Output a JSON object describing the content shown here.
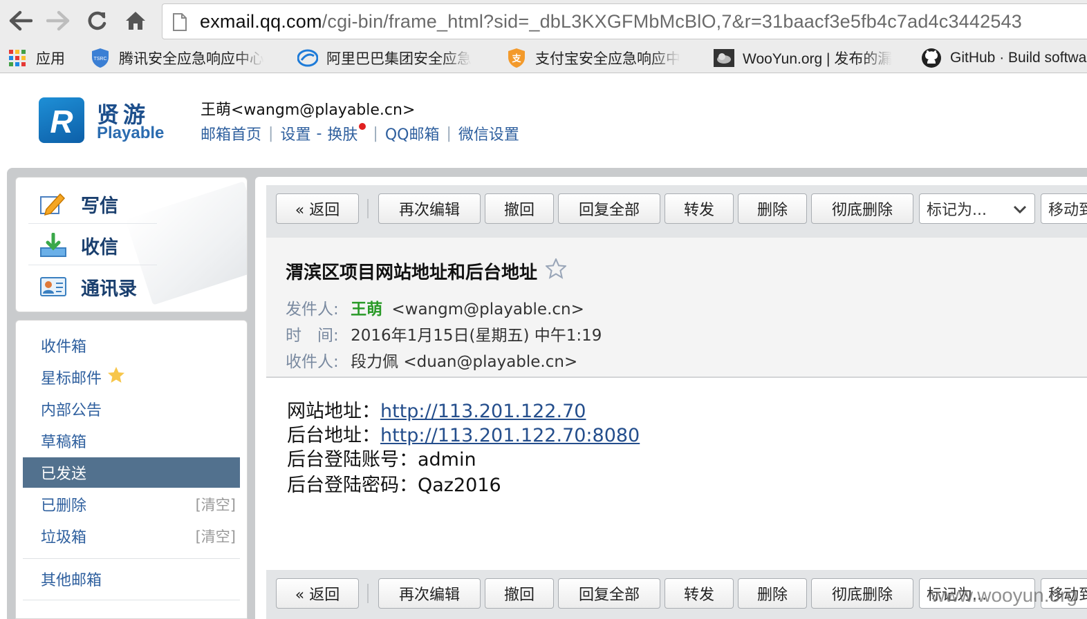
{
  "browser": {
    "url_host": "exmail.qq.com",
    "url_path": "/cgi-bin/frame_html?sid=_dbL3KXGFMbMcBlO,7&r=31baacf3e5fb4c7ad4c3442543",
    "bookmarks": [
      {
        "label": "应用",
        "icon": "apps-grid-icon"
      },
      {
        "label": "腾讯安全应急响应中心",
        "icon": "tsrc-shield-icon"
      },
      {
        "label": "阿里巴巴集团安全应急",
        "icon": "alibaba-icon"
      },
      {
        "label": "支付宝安全应急响应中",
        "icon": "alipay-shield-icon"
      },
      {
        "label": "WooYun.org | 发布的漏",
        "icon": "wooyun-cloud-icon"
      },
      {
        "label": "GitHub · Build software",
        "icon": "github-icon"
      }
    ]
  },
  "header": {
    "logo_cn": "贤游",
    "logo_en": "Playable",
    "user": "王萌<wangm@playable.cn>",
    "links": [
      "邮箱首页",
      "设置",
      "换肤",
      "QQ邮箱",
      "微信设置"
    ],
    "dash": "-",
    "separator": "|"
  },
  "sidebar": {
    "quick_actions": [
      {
        "label": "写信",
        "icon": "compose-pencil-icon"
      },
      {
        "label": "收信",
        "icon": "inbox-download-icon"
      },
      {
        "label": "通讯录",
        "icon": "contacts-card-icon"
      }
    ],
    "folders": [
      {
        "label": "收件箱"
      },
      {
        "label": "星标邮件",
        "icon": "star-icon"
      },
      {
        "label": "内部公告"
      },
      {
        "label": "草稿箱"
      },
      {
        "label": "已发送",
        "active": true
      },
      {
        "label": "已删除",
        "action": "[清空]"
      },
      {
        "label": "垃圾箱",
        "action": "[清空]"
      }
    ],
    "other": "其他邮箱"
  },
  "toolbar": {
    "back": "« 返回",
    "edit_again": "再次编辑",
    "recall": "撤回",
    "reply_all": "回复全部",
    "forward": "转发",
    "delete": "删除",
    "delete_permanent": "彻底删除",
    "mark_as": "标记为...",
    "move_to": "移动到"
  },
  "message": {
    "subject": "渭滨区项目网站地址和后台地址",
    "from_label": "发件人:",
    "from_name": "王萌",
    "from_email": "<wangm@playable.cn>",
    "time_label": "时　间:",
    "time_value": "2016年1月15日(星期五) 中午1:19",
    "to_label": "收件人:",
    "to_value": "段力佩 <duan@playable.cn>",
    "body": [
      {
        "label": "网站地址：",
        "link": "http://113.201.122.70"
      },
      {
        "label": "后台地址：",
        "link": "http://113.201.122.70:8080"
      },
      {
        "label": "后台登陆账号：",
        "value": "admin"
      },
      {
        "label": "后台登陆密码：",
        "value": "Qaz2016"
      }
    ]
  },
  "watermark": "www.wooyun.org"
}
